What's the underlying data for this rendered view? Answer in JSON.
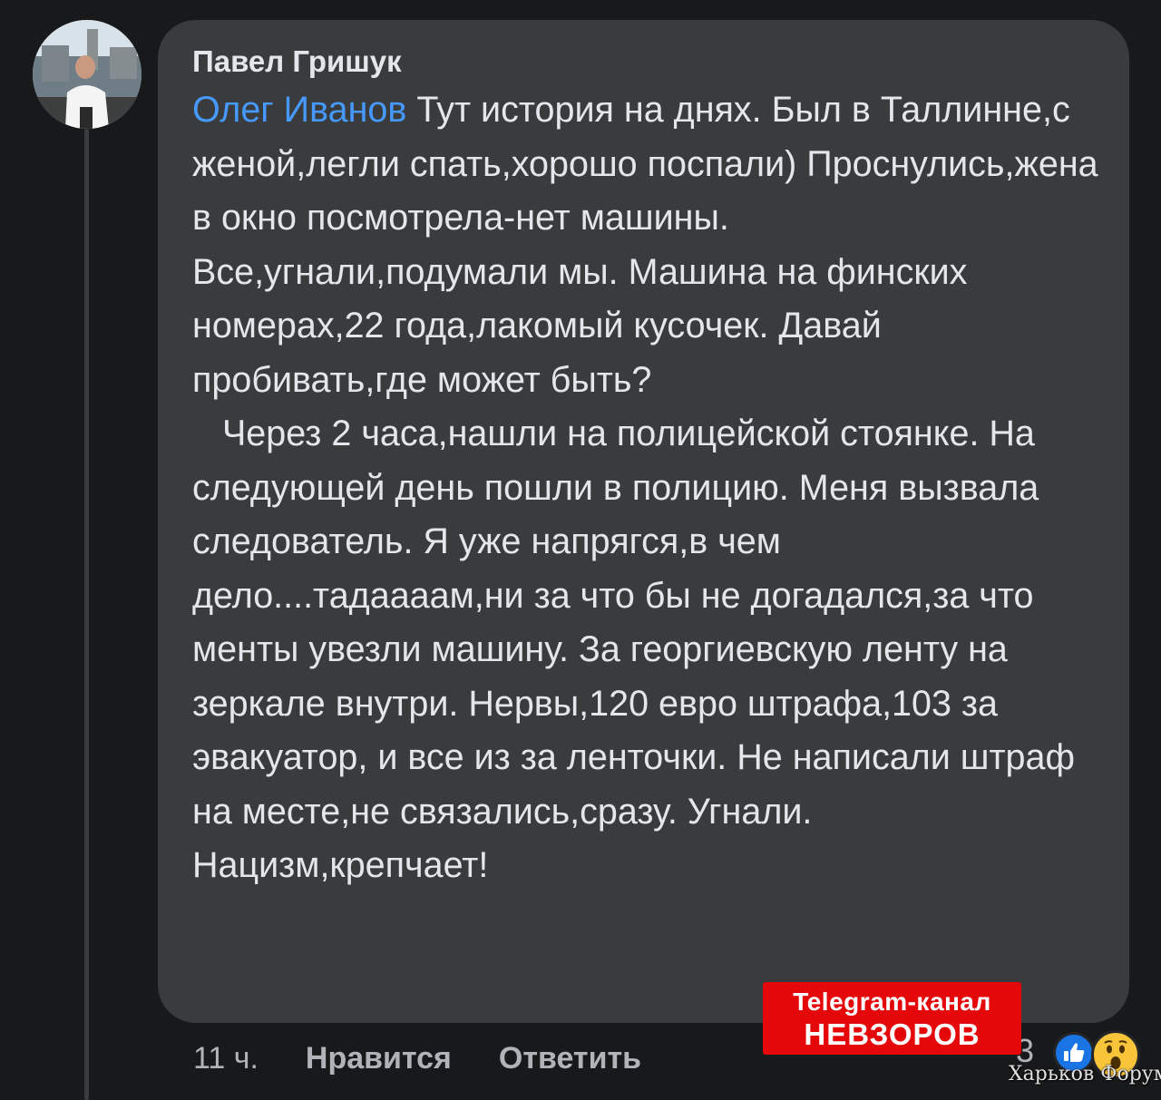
{
  "comment": {
    "author": "Павел Гришук",
    "mention": "Олег Иванов",
    "text": " Тут история на днях. Был в Таллинне,с женой,легли спать,хорошо поспали) Проснулись,жена в окно посмотрела-нет машины.\nВсе,угнали,подумали мы. Машина на финских номерах,22 года,лакомый кусочек. Давай пробивать,где может быть?\n   Через 2 часа,нашли на полицейской стоянке. На следующей день пошли в полицию. Меня вызвала следователь. Я уже напрягся,в чем дело....тадаааам,ни за что бы не догадался,за что менты увезли машину. За георгиевскую ленту на зеркале внутри. Нервы,120 евро штрафа,103 за эвакуатор, и все из за ленточки. Не написали штраф на месте,не связались,сразу. Угнали. Нацизм,крепчает!"
  },
  "actions": {
    "time": "11 ч.",
    "like_label": "Нравится",
    "reply_label": "Ответить"
  },
  "reactions": {
    "count": "3",
    "icons": [
      "like-icon",
      "wow-icon"
    ],
    "like_color": "#1b74e4",
    "wow_color": "#f7c43a"
  },
  "overlay": {
    "badge_line1": "Telegram-канал",
    "badge_line2": "НЕВЗОРОВ",
    "badge_color": "#e4080a",
    "watermark": "Харьков Форум"
  },
  "colors": {
    "background": "#18191a",
    "bubble": "#3a3b3c",
    "text": "#e4e6eb",
    "mention": "#4599ff",
    "secondary": "#b0b3b8"
  }
}
